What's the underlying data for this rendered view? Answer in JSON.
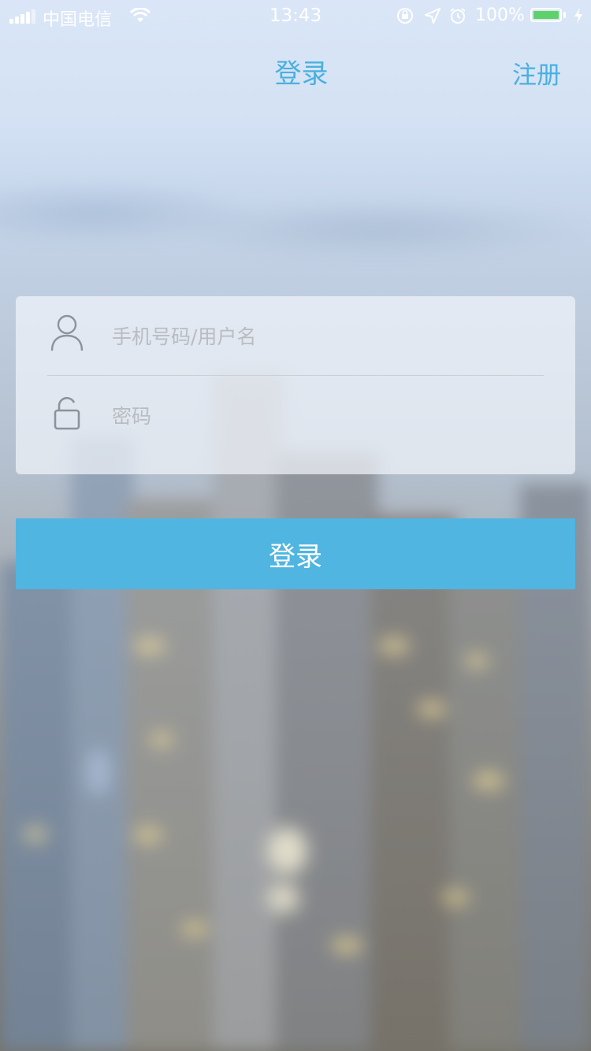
{
  "status_bar": {
    "carrier": "中国电信",
    "time": "13:43",
    "battery": "100%",
    "battery_level": 1.0,
    "icons": [
      "signal-icon",
      "wifi-icon",
      "rotation-lock-icon",
      "location-icon",
      "alarm-icon",
      "battery-icon",
      "charging-icon"
    ]
  },
  "nav": {
    "title": "登录",
    "register_label": "注册"
  },
  "form": {
    "username_placeholder": "手机号码/用户名",
    "username_value": "",
    "username_icon": "user-icon",
    "password_placeholder": "密码",
    "password_value": "",
    "password_icon": "unlock-icon"
  },
  "login_button": {
    "label": "登录",
    "color": "#50b5e1"
  },
  "colors": {
    "accent": "#4ab0e0"
  }
}
